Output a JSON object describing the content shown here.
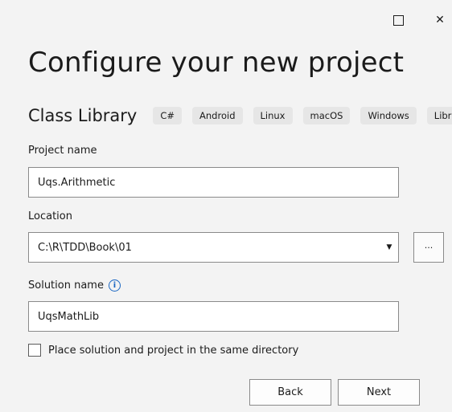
{
  "window": {
    "maximize_icon": "maximize-icon",
    "close_icon": "close-icon",
    "close_glyph": "✕"
  },
  "header": {
    "title": "Configure your new project"
  },
  "template": {
    "name": "Class Library",
    "tags": [
      "C#",
      "Android",
      "Linux",
      "macOS",
      "Windows",
      "Library"
    ]
  },
  "project_name": {
    "label": "Project name",
    "value": "Uqs.Arithmetic"
  },
  "location": {
    "label": "Location",
    "value": "C:\\R\\TDD\\Book\\01",
    "dropdown_glyph": "▼",
    "browse_label": "..."
  },
  "solution_name": {
    "label": "Solution name",
    "info_glyph": "i",
    "value": "UqsMathLib"
  },
  "same_directory": {
    "label": "Place solution and project in the same directory",
    "checked": false
  },
  "footer": {
    "back_label": "Back",
    "next_label": "Next"
  },
  "colors": {
    "background": "#f3f3f3",
    "info_accent": "#1a66c2",
    "input_border": "#8a8a8a"
  }
}
